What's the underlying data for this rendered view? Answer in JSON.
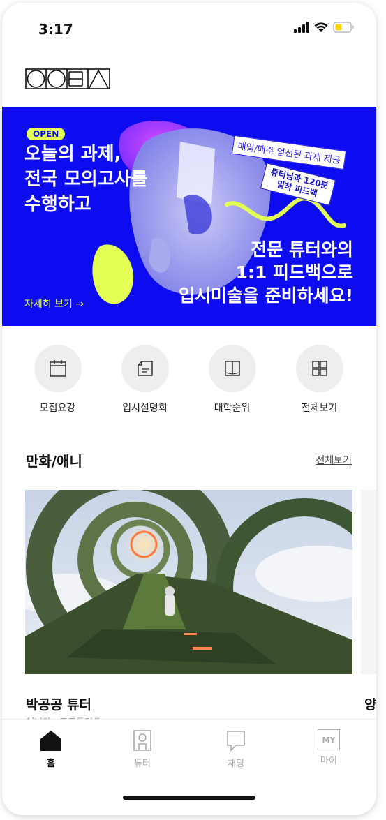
{
  "status_bar": {
    "time": "3:17"
  },
  "banner": {
    "badge": "OPEN",
    "title_lines": [
      "오늘의 과제,",
      "전국 모의고사를",
      "수행하고"
    ],
    "tag1": "매일/매주 엄선된 과제 제공",
    "tag2_lines": [
      "튜터님과 120분",
      "밀착 피드백"
    ],
    "subtitle_lines": [
      "전문 튜터와의",
      "1:1 피드백으로",
      "입시미술을 준비하세요!"
    ],
    "more_link": "자세히 보기 →",
    "colors": {
      "background": "#0d0cf0",
      "accent": "#e3ff55"
    }
  },
  "quick_menu": [
    {
      "label": "모집요강",
      "icon": "calendar-icon"
    },
    {
      "label": "입시설명회",
      "icon": "document-icon"
    },
    {
      "label": "대학순위",
      "icon": "book-icon"
    },
    {
      "label": "전체보기",
      "icon": "grid-icon"
    }
  ],
  "section": {
    "title": "만화/애니",
    "see_all": "전체보기",
    "cards": [
      {
        "name": "박공공 튜터",
        "subtitle": "애니과 · 모모튜터오"
      },
      {
        "name": "양"
      }
    ]
  },
  "tab_bar": {
    "items": [
      {
        "label": "홈",
        "icon": "home-icon",
        "active": true
      },
      {
        "label": "튜터",
        "icon": "tutor-icon",
        "active": false
      },
      {
        "label": "채팅",
        "icon": "chat-icon",
        "active": false
      },
      {
        "label": "마이",
        "icon": "my-icon",
        "icon_text": "MY",
        "active": false
      }
    ]
  }
}
